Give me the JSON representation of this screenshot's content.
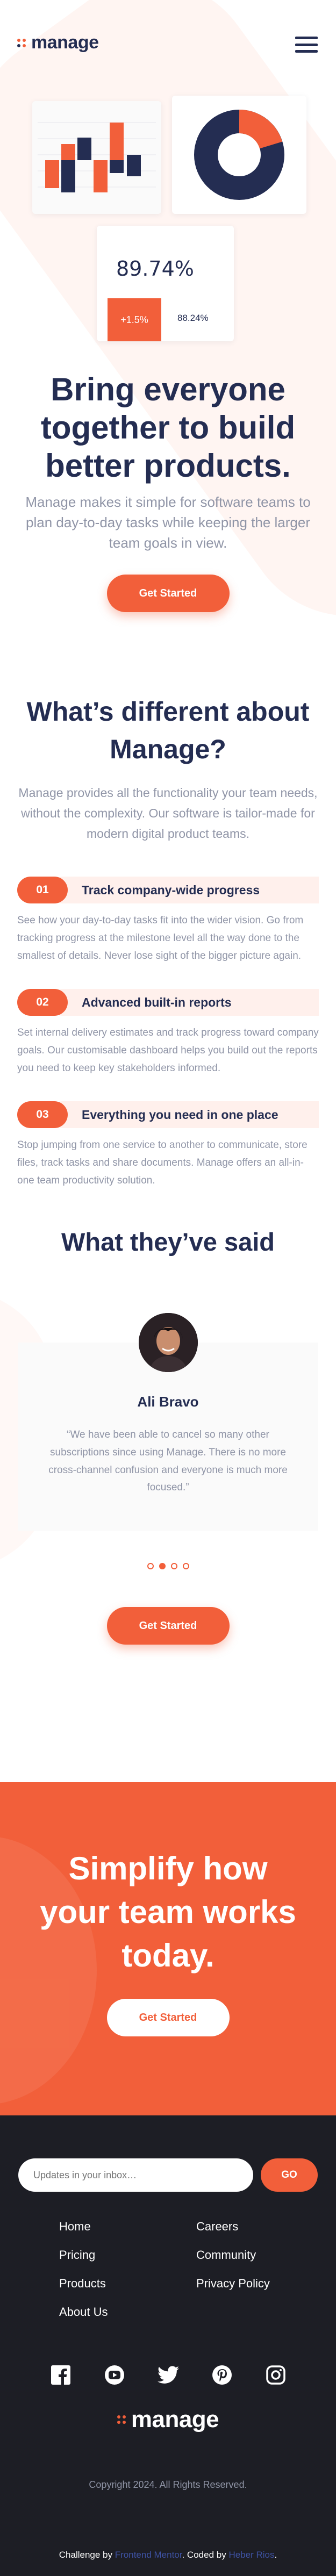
{
  "brand": {
    "name": "manage",
    "accent": "#F25F3A",
    "navy": "#242D52",
    "muted": "#9095A7"
  },
  "header": {
    "menu_icon": "hamburger-icon"
  },
  "hero_illustration": {
    "stat_value": "89.74%",
    "stat_change": "+1.5%",
    "stat_other": "88.24%"
  },
  "hero": {
    "title": "Bring everyone together to build better products.",
    "subtitle": "Manage makes it simple for software teams to plan day-to-day tasks while keeping the larger team goals in view.",
    "cta": "Get Started"
  },
  "different": {
    "title": "What’s different about Manage?",
    "subtitle": "Manage provides all the functionality your team needs, without the complexity. Our software is tailor-made for modern digital product teams.",
    "features": [
      {
        "num": "01",
        "title": "Track company-wide progress",
        "desc": "See how your day-to-day tasks fit into the wider vision. Go from tracking progress at the milestone level all the way done to the smallest of details. Never lose sight of the bigger picture again."
      },
      {
        "num": "02",
        "title": "Advanced built-in reports",
        "desc": "Set internal delivery estimates and track progress toward company goals. Our customisable dashboard helps you build out the reports you need to keep key stakeholders informed."
      },
      {
        "num": "03",
        "title": "Everything you need in one place",
        "desc": "Stop jumping from one service to another to communicate, store files, track tasks and share documents. Manage offers an all-in-one team productivity solution."
      }
    ]
  },
  "testimonials": {
    "title": "What they’ve said",
    "name": "Ali Bravo",
    "quote": "“We have been able to cancel so many other subscriptions since using Manage. There is no more cross-channel confusion and everyone is much more focused.”",
    "dots": 4,
    "active_dot": 1,
    "cta": "Get Started"
  },
  "cta_section": {
    "title": "Simplify how your team works today.",
    "cta": "Get Started"
  },
  "footer": {
    "newsletter_placeholder": "Updates in your inbox…",
    "go_label": "GO",
    "links_col1": [
      "Home",
      "Pricing",
      "Products",
      "About Us"
    ],
    "links_col2": [
      "Careers",
      "Community",
      "Privacy Policy"
    ],
    "socials": [
      "facebook-icon",
      "youtube-icon",
      "twitter-icon",
      "pinterest-icon",
      "instagram-icon"
    ],
    "copyright": "Copyright 2024. All Rights Reserved.",
    "attribution_prefix": "Challenge by ",
    "attribution_fm": "Frontend Mentor",
    "attribution_mid": ". Coded by ",
    "attribution_author": "Heber Rios",
    "attribution_suffix": "."
  }
}
